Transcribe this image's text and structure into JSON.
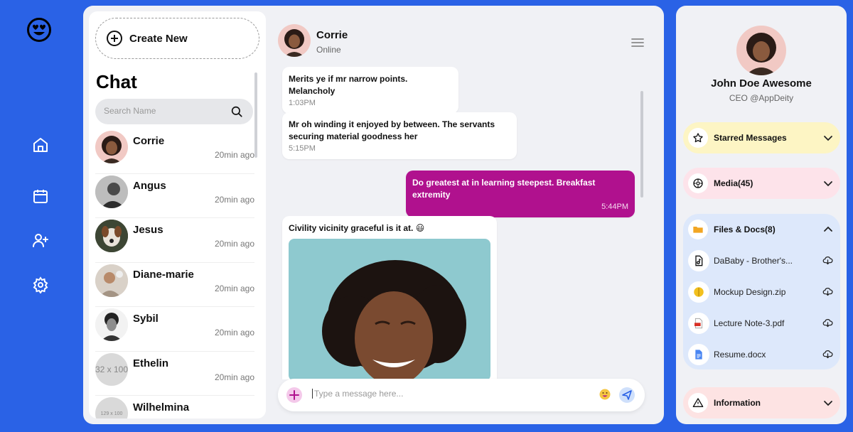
{
  "sidebar_nav": {
    "logo_icon": "smiling-face-with-heart-eyes",
    "items": [
      {
        "icon": "home-icon"
      },
      {
        "icon": "calendar-icon"
      },
      {
        "icon": "add-user-icon"
      },
      {
        "icon": "settings-gear-icon"
      }
    ]
  },
  "chat_list": {
    "create_label": "Create New",
    "title": "Chat",
    "search_placeholder": "Search Name",
    "contacts": [
      {
        "name": "Corrie",
        "time": "20min ago"
      },
      {
        "name": "Angus",
        "time": "20min ago"
      },
      {
        "name": "Jesus",
        "time": "20min ago"
      },
      {
        "name": "Diane-marie",
        "time": "20min ago"
      },
      {
        "name": "Sybil",
        "time": "20min ago"
      },
      {
        "name": "Ethelin",
        "time": "20min ago",
        "avatar_placeholder": "32 x 100"
      },
      {
        "name": "Wilhelmina",
        "time": "",
        "avatar_placeholder": "129 x 100"
      }
    ]
  },
  "conversation": {
    "name": "Corrie",
    "status": "Online",
    "messages": [
      {
        "text": "Merits ye if mr narrow points. Melancholy",
        "time": "1:03PM",
        "direction": "in"
      },
      {
        "text": "Mr oh winding it enjoyed by between. The servants securing material goodness her",
        "time": "5:15PM",
        "direction": "in"
      },
      {
        "text": "Do greatest at in learning steepest. Breakfast extremity",
        "time": "5:44PM",
        "direction": "out"
      },
      {
        "text": "Civility vicinity graceful is it at. 😃",
        "time": "",
        "direction": "in",
        "has_image": true
      }
    ],
    "composer_placeholder": "Type a message here..."
  },
  "profile": {
    "name": "John Doe Awesome",
    "role": "CEO @AppDeity",
    "sections": {
      "starred": {
        "label": "Starred Messages",
        "bg": "#fdf5c4"
      },
      "media": {
        "label": "Media(45)",
        "bg": "#fde3ea"
      },
      "files": {
        "label": "Files & Docs(8)",
        "bg": "#dde8fb",
        "items": [
          {
            "name": "DaBaby - Brother's...",
            "icon": "music-file-icon"
          },
          {
            "name": "Mockup Design.zip",
            "icon": "zip-file-icon"
          },
          {
            "name": "Lecture Note-3.pdf",
            "icon": "pdf-file-icon"
          },
          {
            "name": "Resume.docx",
            "icon": "doc-file-icon"
          }
        ]
      },
      "info": {
        "label": "Information",
        "bg": "#fde3e3"
      }
    }
  },
  "colors": {
    "brand_blue": "#2a62e6",
    "outgoing_bubble": "#b0118e",
    "panel_bg": "#f0f1f5"
  }
}
